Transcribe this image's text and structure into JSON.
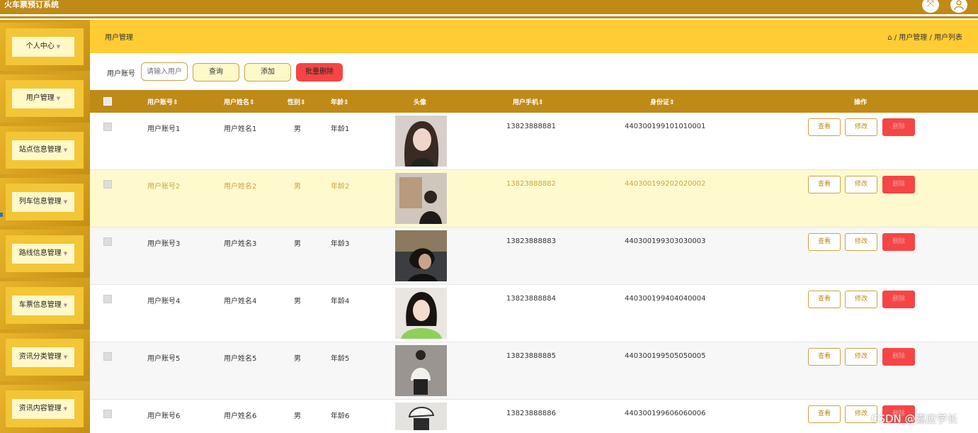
{
  "app": {
    "title": "火车票预订系统"
  },
  "sidebar": {
    "items": [
      {
        "label": "个人中心"
      },
      {
        "label": "用户管理"
      },
      {
        "label": "站点信息管理"
      },
      {
        "label": "列车信息管理"
      },
      {
        "label": "路线信息管理"
      },
      {
        "label": "车票信息管理"
      },
      {
        "label": "资讯分类管理"
      },
      {
        "label": "资讯内容管理"
      }
    ]
  },
  "header": {
    "page_title": "用户管理",
    "breadcrumb": "⌂ / 用户管理 / 用户列表"
  },
  "toolbar": {
    "search_label": "用户账号",
    "search_placeholder": "请输入用户",
    "query": "查询",
    "add": "添加",
    "batch_delete": "批量删除"
  },
  "table": {
    "headers": [
      "用户账号⇕",
      "用户姓名⇕",
      "性别⇕",
      "年龄⇕",
      "头像",
      "用户手机⇕",
      "身份证⇕",
      "操作"
    ],
    "rows": [
      {
        "account": "用户账号1",
        "name": "用户姓名1",
        "gender": "男",
        "age": "年龄1",
        "phone": "13823888881",
        "id_card": "440300199101010001"
      },
      {
        "account": "用户账号2",
        "name": "用户姓名2",
        "gender": "男",
        "age": "年龄2",
        "phone": "13823888882",
        "id_card": "440300199202020002"
      },
      {
        "account": "用户账号3",
        "name": "用户姓名3",
        "gender": "男",
        "age": "年龄3",
        "phone": "13823888883",
        "id_card": "440300199303030003"
      },
      {
        "account": "用户账号4",
        "name": "用户姓名4",
        "gender": "男",
        "age": "年龄4",
        "phone": "13823888884",
        "id_card": "440300199404040004"
      },
      {
        "account": "用户账号5",
        "name": "用户姓名5",
        "gender": "男",
        "age": "年龄5",
        "phone": "13823888885",
        "id_card": "440300199505050005"
      },
      {
        "account": "用户账号6",
        "name": "用户姓名6",
        "gender": "男",
        "age": "年龄6",
        "phone": "13823888886",
        "id_card": "440300199606060006"
      }
    ],
    "actions": {
      "view": "查看",
      "edit": "修改",
      "delete": "删除"
    }
  },
  "watermark": "CSDN @嘉应学长",
  "colors": {
    "accent": "#c08a17",
    "header": "#ffcc33",
    "danger": "#f64545",
    "highlight_row": "#fffacd"
  }
}
